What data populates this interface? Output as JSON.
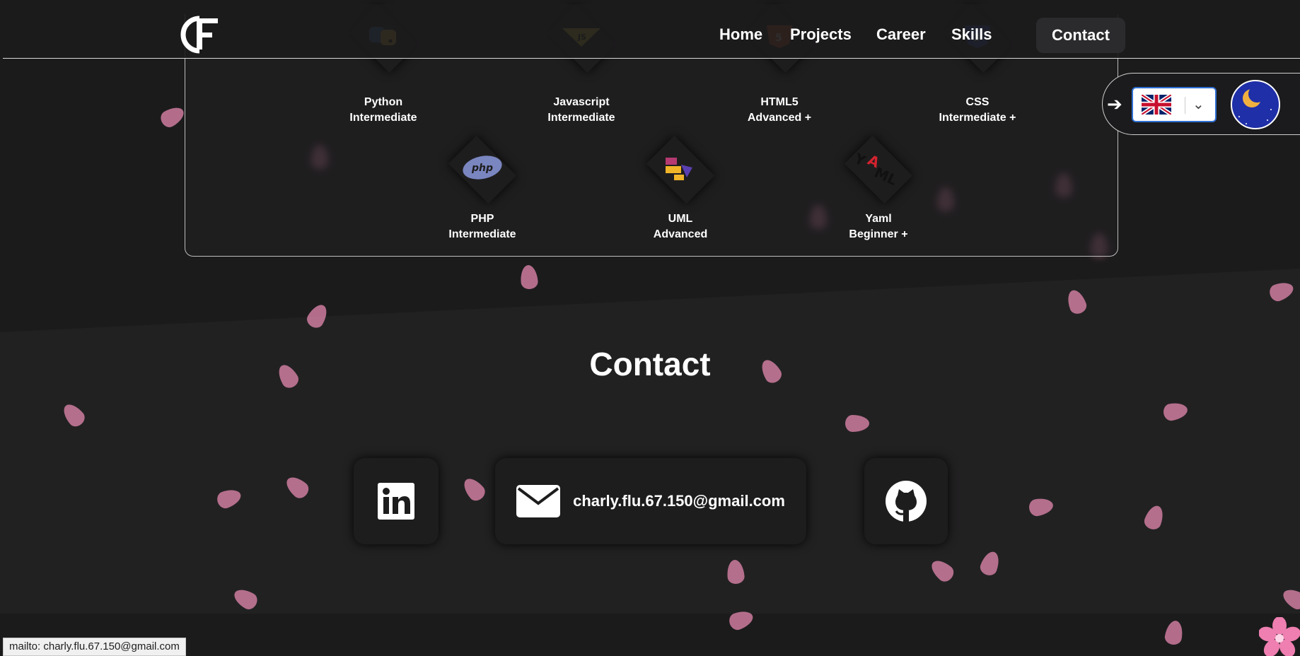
{
  "nav": {
    "logo_text": "CF",
    "links": [
      "Home",
      "Projects",
      "Career",
      "Skills"
    ],
    "contact_label": "Contact"
  },
  "skills": [
    {
      "name": "Python",
      "level": "Intermediate"
    },
    {
      "name": "Javascript",
      "level": "Intermediate"
    },
    {
      "name": "HTML5",
      "level": "Advanced +"
    },
    {
      "name": "CSS",
      "level": "Intermediate +"
    },
    {
      "name": "PHP",
      "level": "Intermediate"
    },
    {
      "name": "UML",
      "level": "Advanced"
    },
    {
      "name": "Yaml",
      "level": "Beginner +"
    }
  ],
  "language": {
    "selected": "English (UK flag)"
  },
  "theme": {
    "mode": "dark (moon icon)"
  },
  "contact": {
    "title": "Contact",
    "email": "charly.flu.67.150@gmail.com",
    "links": [
      "linkedin-icon",
      "mail-icon",
      "github-icon"
    ]
  },
  "status_bar": {
    "text": "mailto: charly.flu.67.150@gmail.com"
  },
  "colors": {
    "background": "#222122",
    "accent_pink": "#e58ab0",
    "theme_blue": "#1f2fa8"
  }
}
